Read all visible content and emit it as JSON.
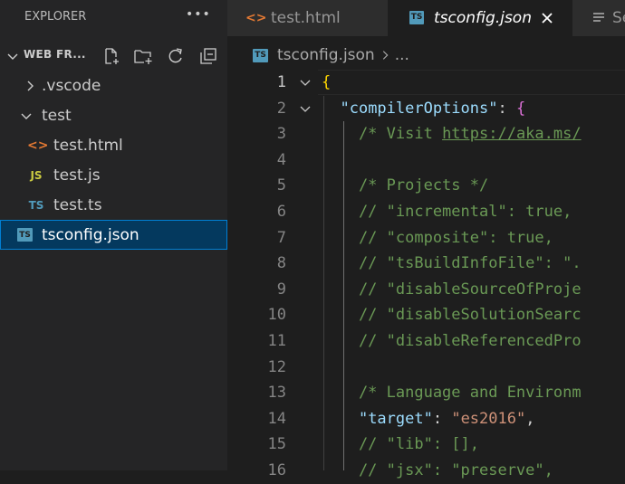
{
  "sidebar": {
    "header_title": "EXPLORER",
    "more_label": "•••",
    "section_title": "WEB FR...",
    "tree": [
      {
        "label": ".vscode",
        "type": "folder",
        "expanded": false,
        "indent": 1
      },
      {
        "label": "test",
        "type": "folder",
        "expanded": true,
        "indent": 1
      },
      {
        "label": "test.html",
        "type": "file",
        "icon": "html-icon",
        "icon_text": "<>",
        "indent": 2
      },
      {
        "label": "test.js",
        "type": "file",
        "icon": "js-icon",
        "icon_text": "JS",
        "indent": 2
      },
      {
        "label": "test.ts",
        "type": "file",
        "icon": "ts-icon",
        "icon_text": "TS",
        "indent": 2
      },
      {
        "label": "tsconfig.json",
        "type": "file",
        "icon": "tsconfig-icon",
        "icon_text": "TS",
        "indent": 1,
        "selected": true
      }
    ]
  },
  "tabs": [
    {
      "label": "test.html",
      "active": false,
      "icon_text": "<>"
    },
    {
      "label": "tsconfig.json",
      "active": true,
      "icon_text": "TS"
    },
    {
      "label": "Se",
      "active": false
    }
  ],
  "breadcrumb": {
    "file": "tsconfig.json",
    "ellipsis": "..."
  },
  "code": {
    "line_numbers": [
      "1",
      "2",
      "3",
      "4",
      "5",
      "6",
      "7",
      "8",
      "9",
      "10",
      "11",
      "12",
      "13",
      "14",
      "15",
      "16"
    ],
    "lines": [
      "{",
      "  \"compilerOptions\": {",
      "    /* Visit https://aka.ms/",
      "",
      "    /* Projects */",
      "    // \"incremental\": true,",
      "    // \"composite\": true,",
      "    // \"tsBuildInfoFile\": \".",
      "    // \"disableSourceOfProje",
      "    // \"disableSolutionSearc",
      "    // \"disableReferencedPro",
      "",
      "    /* Language and Environm",
      "    \"target\": \"es2016\",",
      "    // \"lib\": [],",
      "    // \"jsx\": \"preserve\","
    ]
  },
  "colors": {
    "accent": "#007fd4",
    "selection": "#04395e",
    "key": "#9cdcfe",
    "string": "#ce9178",
    "comment": "#6a9955"
  }
}
